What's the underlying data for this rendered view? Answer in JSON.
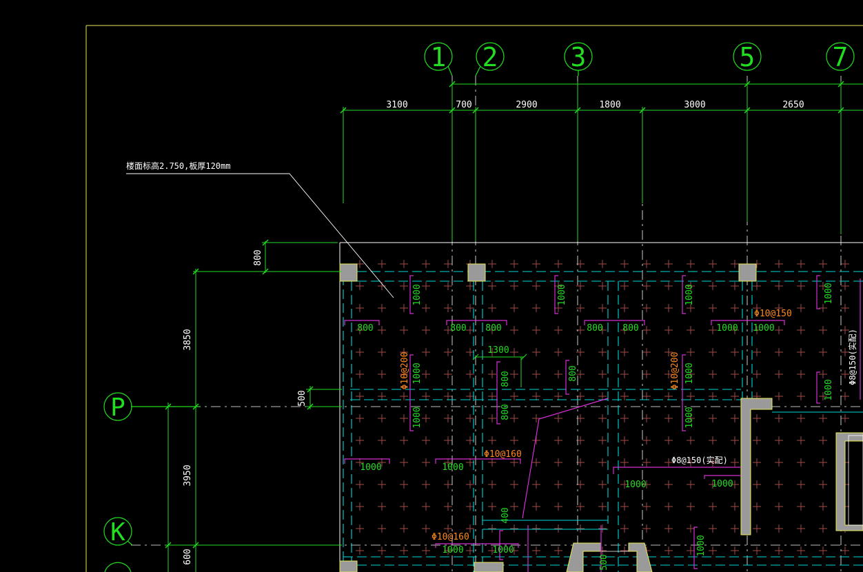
{
  "colors": {
    "background": "#000000",
    "frame": "#e8e85a",
    "slab_edge": "#ffffff",
    "dimension": "#22dd22",
    "axis_line": "#ffffff",
    "beam": "#00d8d8",
    "rebar_bottom": "#d430d4",
    "rebar_label": "#22dd22",
    "spec_label": "#ff8a1a",
    "grid_mark": "#a04a4a",
    "column_fill": "#9a9a9a",
    "wall_edge": "#e8e85a",
    "leader": "#ffffff"
  },
  "note": {
    "text": "楼面标高2.750,板厚120mm"
  },
  "axes_top": [
    {
      "id": "1"
    },
    {
      "id": "2"
    },
    {
      "id": "3"
    },
    {
      "id": "5"
    },
    {
      "id": "7"
    }
  ],
  "axes_left": [
    {
      "id": "P"
    },
    {
      "id": "K"
    }
  ],
  "dims_top": [
    "3100",
    "700",
    "2900",
    "1800",
    "3000",
    "2650"
  ],
  "dims_left": {
    "top_offset": "800",
    "span_upper": "3850",
    "beam_width": "500",
    "span_lower": "3950",
    "bottom_offset": "600"
  },
  "rebar_labels": {
    "r1": "1000",
    "r2": "1000",
    "r3": "1000",
    "r4": "1000",
    "r5": "800",
    "r6": "800",
    "r7": "800",
    "r8": "800",
    "r9": "800",
    "r10": "1000",
    "r11": "1000",
    "r12": "1300",
    "r13": "1000",
    "r14": "800",
    "r15": "800",
    "r16": "800",
    "r17": "1000",
    "r18": "1000",
    "r19": "1000",
    "r20": "1000",
    "r21": "1000",
    "r22": "1000",
    "r23": "1000",
    "r24": "1000",
    "r25": "400",
    "r26": "1000",
    "r27": "1000",
    "r28": "1000",
    "r29": "500"
  },
  "specs": {
    "s1": "Φ10@150",
    "s2": "Φ10@200",
    "s3": "Φ10@200",
    "s4": "Φ10@160",
    "s5": "Φ10@160",
    "s6": "Φ8@150(实配)",
    "s7": "Φ8@150(实配)"
  }
}
